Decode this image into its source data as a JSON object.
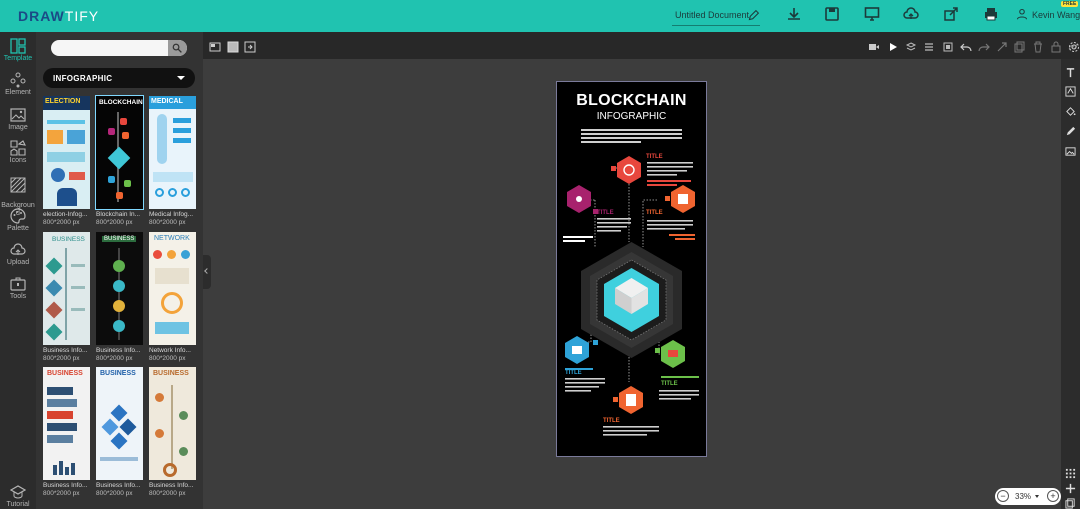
{
  "brand": {
    "name_a": "DRAW",
    "name_b": "TIFY"
  },
  "header": {
    "doc_title": "Untitled Document",
    "user_name": "Kevin Wang",
    "badge": "FREE"
  },
  "rail": {
    "items": [
      {
        "label": "Template",
        "icon": "template-icon"
      },
      {
        "label": "Element",
        "icon": "element-icon"
      },
      {
        "label": "Image",
        "icon": "image-icon"
      },
      {
        "label": "Icons",
        "icon": "icons-icon"
      },
      {
        "label": "Backgroun\nd",
        "icon": "background-icon"
      },
      {
        "label": "Palette",
        "icon": "palette-icon"
      },
      {
        "label": "Upload",
        "icon": "upload-icon"
      },
      {
        "label": "Tools",
        "icon": "tools-icon"
      },
      {
        "label": "Tutorial",
        "icon": "tutorial-icon"
      }
    ]
  },
  "panel": {
    "search_placeholder": "",
    "category": "INFOGRAPHIC",
    "templates": [
      {
        "name": "election-Infog...",
        "size": "800*2000 px",
        "title": "ELECTION"
      },
      {
        "name": "Blockchain In...",
        "size": "800*2000 px",
        "title": "BLOCKCHAIN"
      },
      {
        "name": "Medical Infog...",
        "size": "800*2000 px",
        "title": "MEDICAL"
      },
      {
        "name": "Business Info...",
        "size": "800*2000 px",
        "title": "BUSINESS"
      },
      {
        "name": "Business Info...",
        "size": "800*2000 px",
        "title": "BUSINESS"
      },
      {
        "name": "Network Info...",
        "size": "800*2000 px",
        "title": "NETWORK"
      },
      {
        "name": "Business Info...",
        "size": "800*2000 px",
        "title": "BUSINESS"
      },
      {
        "name": "Business Info...",
        "size": "800*2000 px",
        "title": "BUSINESS"
      },
      {
        "name": "Business Info...",
        "size": "800*2000 px",
        "title": "BUSINESS"
      }
    ]
  },
  "doc": {
    "title": "BLOCKCHAIN",
    "subtitle": "INFOGRAPHIC",
    "node_label": "TITLE"
  },
  "zoom": {
    "value": "33%"
  },
  "colors": {
    "accent": "#20c3b0",
    "brand": "#1b4a86"
  }
}
